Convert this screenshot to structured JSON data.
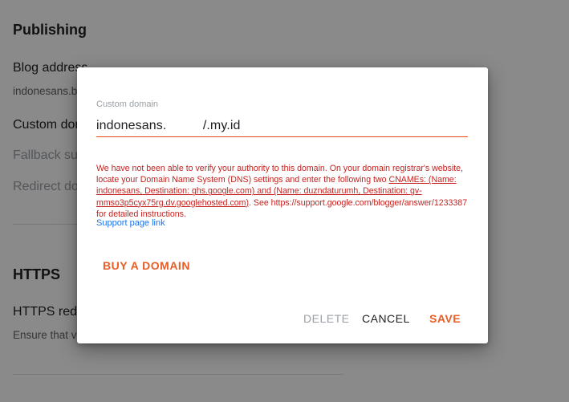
{
  "background": {
    "publishing": {
      "section_title": "Publishing",
      "blog_address_title": "Blog address",
      "blog_address_value": "indonesans.b",
      "custom_domain_title": "Custom dom",
      "fallback_title": "Fallback su",
      "redirect_title": "Redirect do"
    },
    "https": {
      "section_title": "HTTPS",
      "redirect_title": "HTTPS redi",
      "redirect_sub": "Ensure that v"
    }
  },
  "dialog": {
    "field_label": "Custom domain",
    "field_value": "indonesans.          /.my.id",
    "error": {
      "part1": "We have not been able to verify your authority to this domain. On your domain registrar's website, locate your Domain Name System (DNS) settings and enter the following two ",
      "part2_underlined": "CNAMEs: (Name: indonesans, Destination: ghs.google.com) and (Name: duzndaturumh, Destination: gv-mmso3p5cyx75rg.dv.googlehosted.com)",
      "part3": ". See https://support.google.com/blogger/answer/1233387 for detailed instructions."
    },
    "support_link": "Support page link",
    "buy_domain_label": "BUY A DOMAIN",
    "delete_label": "DELETE",
    "cancel_label": "CANCEL",
    "save_label": "SAVE"
  }
}
